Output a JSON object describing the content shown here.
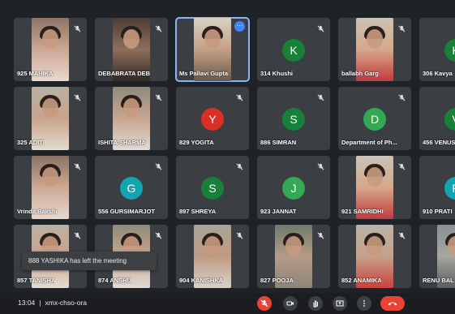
{
  "tiles": [
    {
      "name": "925 MAHIKA",
      "type": "video",
      "muted": true
    },
    {
      "name": "DEBABRATA DEB",
      "type": "video",
      "muted": true
    },
    {
      "name": "Ms Pallavi Gupta",
      "type": "video",
      "muted": false,
      "active": true
    },
    {
      "name": "314 Khushi",
      "type": "avatar",
      "initial": "K",
      "color": "#188038",
      "muted": true
    },
    {
      "name": "ballabh Garg",
      "type": "video",
      "muted": true
    },
    {
      "name": "306 Kavya",
      "type": "avatar",
      "initial": "K",
      "color": "#188038",
      "muted": false
    },
    {
      "name": "325 ADITI",
      "type": "video",
      "muted": true
    },
    {
      "name": "ISHITA SHARMA",
      "type": "video",
      "muted": true
    },
    {
      "name": "829 YOGITA",
      "type": "avatar",
      "initial": "Y",
      "color": "#d93025",
      "muted": true
    },
    {
      "name": "886 SIMRAN",
      "type": "avatar",
      "initial": "S",
      "color": "#188038",
      "muted": true
    },
    {
      "name": "Department of Ph...",
      "type": "avatar",
      "initial": "D",
      "color": "#34a853",
      "muted": true
    },
    {
      "name": "456 VENUS",
      "type": "avatar",
      "initial": "V",
      "color": "#188038",
      "muted": false
    },
    {
      "name": "Vrinda Bakshi",
      "type": "video",
      "muted": true
    },
    {
      "name": "556 GURSIMARJOT",
      "type": "avatar",
      "initial": "G",
      "color": "#12a4af",
      "muted": true
    },
    {
      "name": "897 SHREYA",
      "type": "avatar",
      "initial": "S",
      "color": "#188038",
      "muted": true
    },
    {
      "name": "923 JANNAT",
      "type": "avatar",
      "initial": "J",
      "color": "#34a853",
      "muted": true
    },
    {
      "name": "921 SAMRIDHI",
      "type": "video",
      "muted": true
    },
    {
      "name": "910 PRATI",
      "type": "avatar",
      "initial": "P",
      "color": "#12a4af",
      "muted": false
    },
    {
      "name": "857 TANISHA",
      "type": "video",
      "muted": true
    },
    {
      "name": "874 ANSHU",
      "type": "video",
      "muted": true
    },
    {
      "name": "904 KANISHKA",
      "type": "video",
      "muted": true
    },
    {
      "name": "827 POOJA",
      "type": "video",
      "muted": true
    },
    {
      "name": "852 ANAMIKA",
      "type": "video",
      "muted": true
    },
    {
      "name": "RENU BAL",
      "type": "video",
      "muted": false
    }
  ],
  "toast": "888 YASHIKA has left the meeting",
  "footer": {
    "time": "13:04",
    "separator": "|",
    "meeting_code": "xmx-chso-ora"
  },
  "controls": [
    "mic-off-icon",
    "camera-icon",
    "raise-hand-icon",
    "present-icon",
    "more-options-icon",
    "end-call-icon"
  ],
  "colors": {
    "background": "#1f2226",
    "tile": "#3b3e43",
    "active_outline": "#8ab4f8",
    "danger": "#ea4335"
  }
}
